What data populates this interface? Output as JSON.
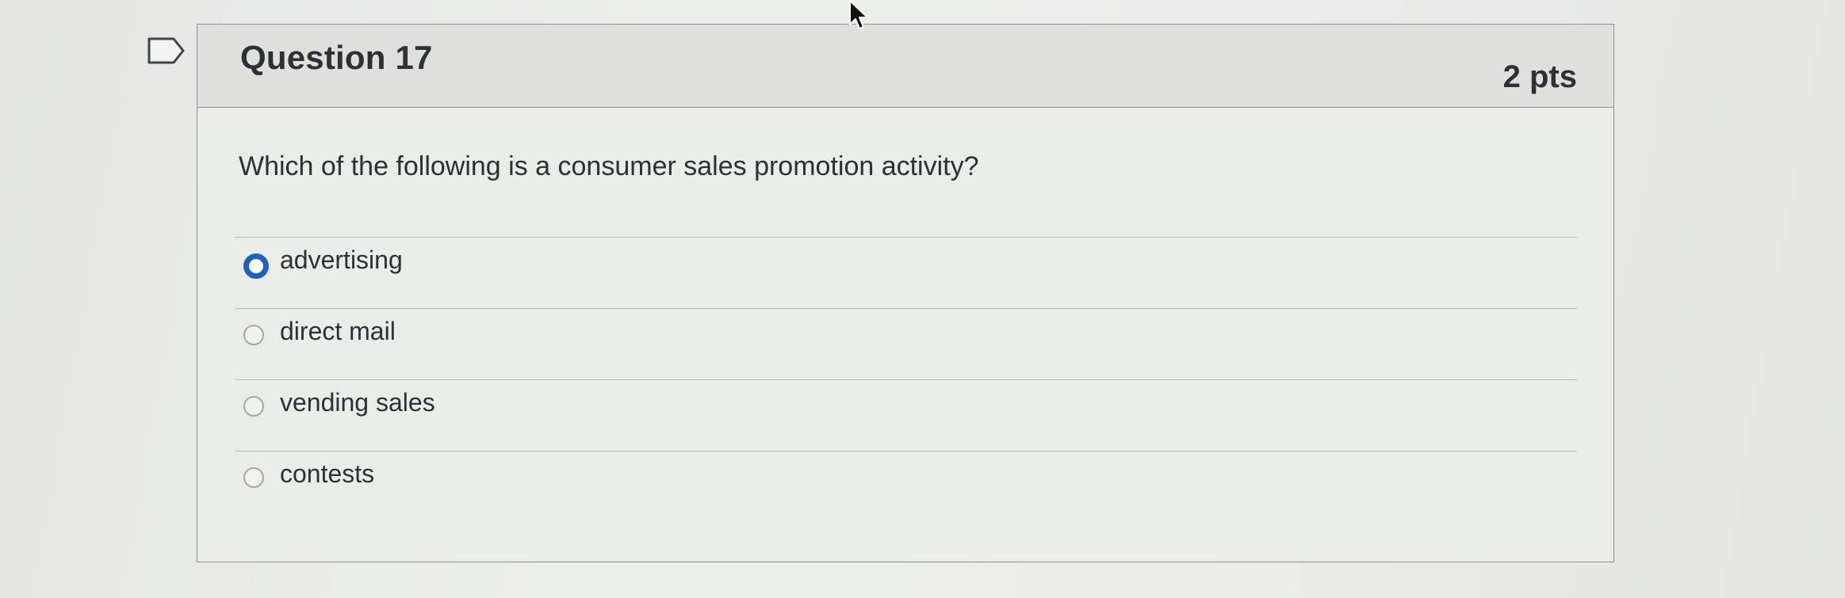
{
  "question": {
    "title": "Question 17",
    "points": "2 pts",
    "prompt": "Which of the following is a consumer sales promotion activity?",
    "flag_icon": "bookmark-flag-icon"
  },
  "answers": [
    {
      "label": "advertising",
      "selected": true
    },
    {
      "label": "direct mail",
      "selected": false
    },
    {
      "label": "vending sales",
      "selected": false
    },
    {
      "label": "contests",
      "selected": false
    }
  ],
  "colors": {
    "selected_radio": "#1f5fc2",
    "border": "#8a8f92",
    "header_bg": "#dfe0dd"
  }
}
